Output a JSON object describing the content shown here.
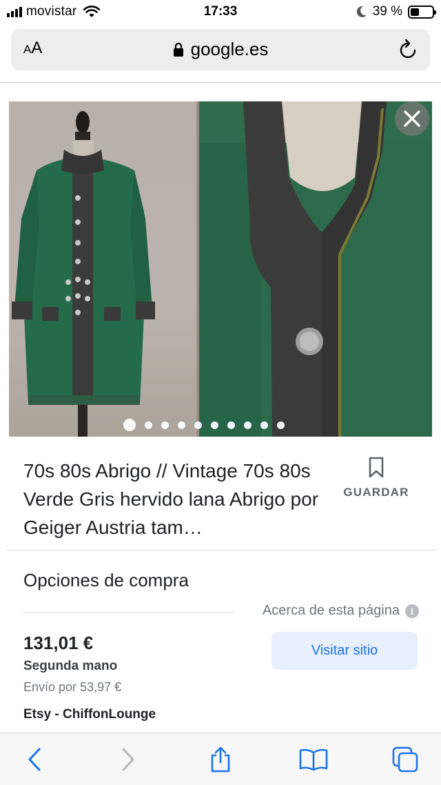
{
  "status_bar": {
    "carrier": "movistar",
    "time": "17:33",
    "battery_percent": "39 %",
    "battery_level": 0.39
  },
  "browser": {
    "text_size_label_small": "A",
    "text_size_label_large": "A",
    "url": "google.es",
    "accent_color": "#1a73e8"
  },
  "carousel": {
    "image_count": 10,
    "active_index": 0,
    "close_icon": "close-icon"
  },
  "product": {
    "title": "70s 80s Abrigo // Vintage 70s 80s Verde Gris hervido lana Abrigo por Geiger Austria tam…",
    "save_label": "GUARDAR"
  },
  "purchase": {
    "heading": "Opciones de compra",
    "about_page": "Acerca de esta página",
    "price": "131,01 €",
    "condition": "Segunda mano",
    "shipping": "Envío por 53,97 €",
    "visit_button": "Visitar sitio",
    "seller": "Etsy - ChiffonLounge"
  },
  "toolbar": {
    "icons": [
      "back-icon",
      "forward-icon",
      "share-icon",
      "bookmarks-icon",
      "tabs-icon"
    ]
  }
}
